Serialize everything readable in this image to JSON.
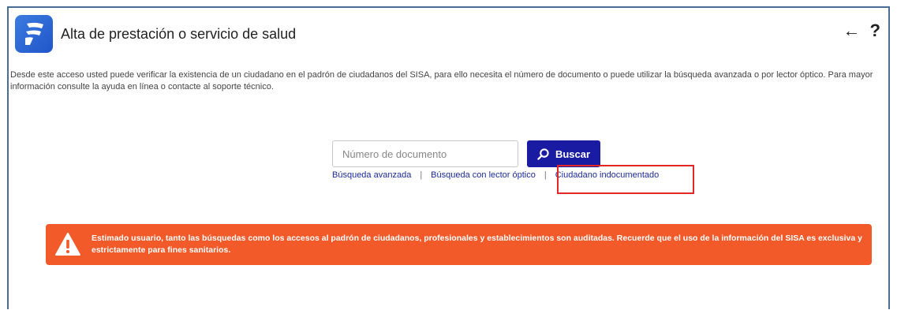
{
  "header": {
    "title": "Alta de prestación o servicio de salud",
    "back_icon_glyph": "←",
    "help_icon_glyph": "?"
  },
  "description": "Desde este acceso usted puede verificar la existencia de un ciudadano en el padrón de ciudadanos del SISA, para ello necesita el número de documento o puede utilizar la búsqueda avanzada o por lector óptico. Para mayor información consulte la ayuda en línea o contacte al soporte técnico.",
  "search": {
    "placeholder": "Número de documento",
    "button_label": "Buscar"
  },
  "links": {
    "advanced": "Búsqueda avanzada",
    "optical": "Búsqueda con lector óptico",
    "undocumented": "Ciudadano indocumentado",
    "separator": "|"
  },
  "warning": {
    "text": "Estimado usuario, tanto las búsquedas como los accesos al padrón de ciudadanos, profesionales y establecimientos son auditadas. Recuerde que el uso de la información del SISA es exclusiva y estrictamente para fines sanitarios."
  },
  "colors": {
    "primary_button": "#1a1ba3",
    "warning_bg": "#f25a29",
    "highlight_border": "#e32626",
    "frame_border": "#4a6d96"
  },
  "icons": [
    "app-logo-icon",
    "back-arrow-icon",
    "help-icon",
    "search-icon",
    "warning-icon"
  ]
}
